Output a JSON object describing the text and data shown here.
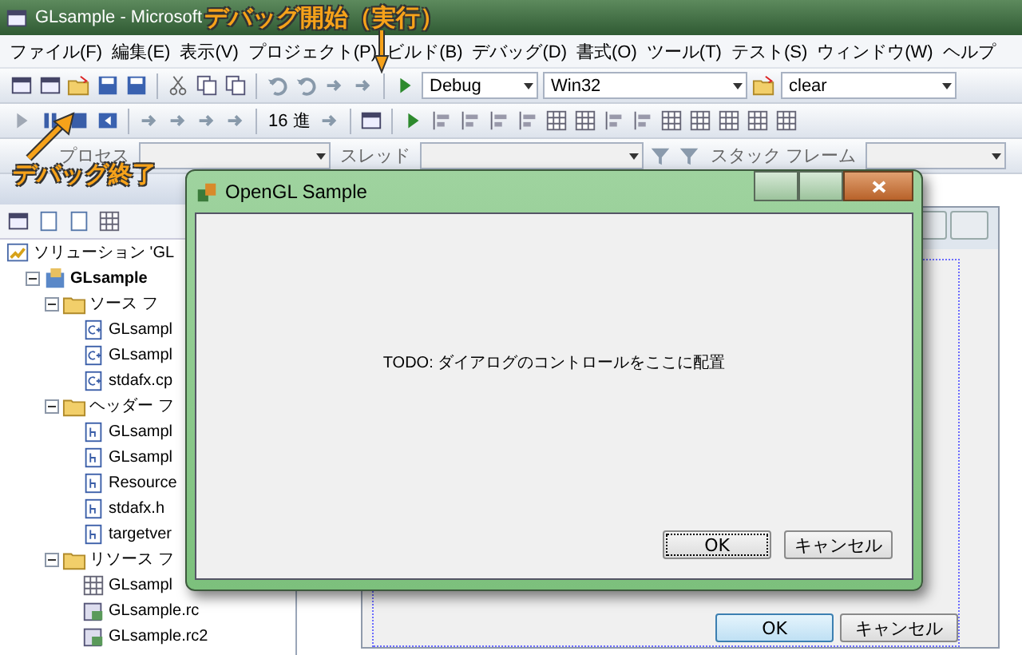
{
  "window": {
    "title": "GLsample - Microsoft"
  },
  "menu": [
    "ファイル(F)",
    "編集(E)",
    "表示(V)",
    "プロジェクト(P)",
    "ビルド(B)",
    "デバッグ(D)",
    "書式(O)",
    "ツール(T)",
    "テスト(S)",
    "ウィンドウ(W)",
    "ヘルプ"
  ],
  "standard_toolbar": {
    "configuration": "Debug",
    "platform": "Win32",
    "find": "clear"
  },
  "debug_toolbar": {
    "hex_button": "16 進"
  },
  "debug_location_toolbar": {
    "process_label": "プロセス",
    "thread_label": "スレッド",
    "stack_frame_label": "スタック フレーム"
  },
  "solution_explorer": {
    "tree": [
      {
        "label": "ソリューション 'GL",
        "kind": "solution",
        "children": [
          {
            "label": "GLsample",
            "kind": "project",
            "expanded": true,
            "children": [
              {
                "label": "ソース フ",
                "kind": "folder",
                "expanded": true,
                "children": [
                  {
                    "label": "GLsampl",
                    "kind": "cpp"
                  },
                  {
                    "label": "GLsampl",
                    "kind": "cpp"
                  },
                  {
                    "label": "stdafx.cp",
                    "kind": "cpp"
                  }
                ]
              },
              {
                "label": "ヘッダー フ",
                "kind": "folder",
                "expanded": true,
                "children": [
                  {
                    "label": "GLsampl",
                    "kind": "h"
                  },
                  {
                    "label": "GLsampl",
                    "kind": "h"
                  },
                  {
                    "label": "Resource",
                    "kind": "h"
                  },
                  {
                    "label": "stdafx.h",
                    "kind": "h"
                  },
                  {
                    "label": "targetver",
                    "kind": "h"
                  }
                ]
              },
              {
                "label": "リソース フ",
                "kind": "folder",
                "expanded": true,
                "children": [
                  {
                    "label": "GLsampl",
                    "kind": "grid"
                  },
                  {
                    "label": "GLsample.rc",
                    "kind": "rc"
                  },
                  {
                    "label": "GLsample.rc2",
                    "kind": "rc"
                  }
                ]
              }
            ]
          }
        ]
      }
    ]
  },
  "designer": {
    "buttons": [
      "OK",
      "キャンセル"
    ]
  },
  "dialog": {
    "title": "OpenGL Sample",
    "message": "TODO: ダイアログのコントロールをここに配置",
    "buttons": [
      "OK",
      "キャンセル"
    ]
  },
  "annotations": [
    {
      "text": "デバッグ開始（実行）",
      "kind": "start"
    },
    {
      "text": "デバッグ終了",
      "kind": "stop"
    }
  ]
}
